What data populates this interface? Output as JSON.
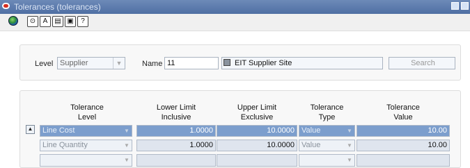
{
  "window": {
    "title": "Tolerances (tolerances)"
  },
  "toolbar": {
    "icons": [
      "globe-icon",
      "clock-icon",
      "binoculars-icon",
      "folder-icon",
      "print-icon",
      "help-icon"
    ],
    "glyphs": [
      "⊙",
      "A",
      "▤",
      "▣",
      "?"
    ]
  },
  "search_panel": {
    "level_label": "Level",
    "level_value": "Supplier",
    "name_label": "Name",
    "name_value": "11",
    "name_desc": "EIT Supplier Site",
    "search_button": "Search"
  },
  "table": {
    "headers": [
      [
        "Tolerance",
        "Level"
      ],
      [
        "Lower Limit",
        "Inclusive"
      ],
      [
        "Upper Limit",
        "Exclusive"
      ],
      [
        "Tolerance",
        "Type"
      ],
      [
        "Tolerance",
        "Value"
      ]
    ],
    "rows": [
      {
        "level": "Line Cost",
        "lower": "1.0000",
        "upper": "10.0000",
        "type": "Value",
        "value": "10.00"
      },
      {
        "level": "Line Quantity",
        "lower": "1.0000",
        "upper": "10.0000",
        "type": "Value",
        "value": "10.00"
      },
      {
        "level": "",
        "lower": "",
        "upper": "",
        "type": "",
        "value": ""
      }
    ]
  },
  "colors": {
    "titlebar": "#5a78ad",
    "selected": "#7c9ecd"
  }
}
